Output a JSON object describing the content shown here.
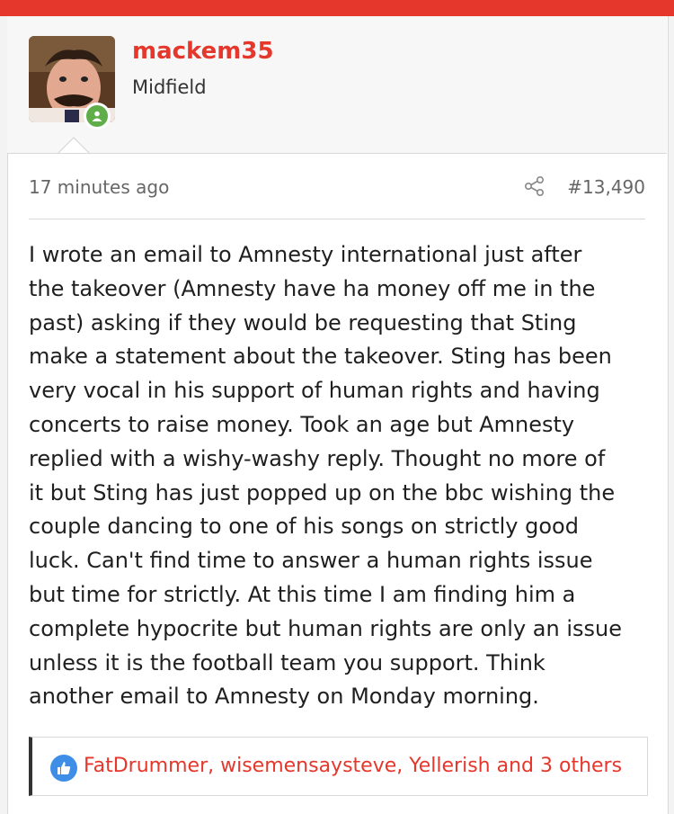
{
  "colors": {
    "accent": "#e5372b",
    "online": "#5fae4a",
    "like": "#3e8ee8"
  },
  "author": {
    "username": "mackem35",
    "title": "Midfield"
  },
  "post": {
    "time": "17 minutes ago",
    "number": "#13,490",
    "body": "I wrote an email to Amnesty international just after\nthe takeover (Amnesty have ha money off me in the\npast) asking if they would be requesting that Sting\nmake a statement about the takeover. Sting has been\nvery vocal in his support of human rights and having\nconcerts to raise money. Took an age but Amnesty\nreplied with a wishy-washy reply. Thought no more of\nit but Sting has just popped up on the bbc wishing the\ncouple dancing to one of his songs on strictly good\nluck. Can't find time to answer a human rights issue\nbut time for strictly. At this time I am finding him a\ncomplete hypocrite but human rights are only an issue\nunless it is the football team you support. Think\nanother email to Amnesty on Monday morning."
  },
  "reactions": {
    "icon": "like-icon",
    "text": "FatDrummer, wisemensaysteve, Yellerish and 3 others"
  },
  "icons": {
    "share": "share-icon",
    "online": "online-status-icon"
  }
}
